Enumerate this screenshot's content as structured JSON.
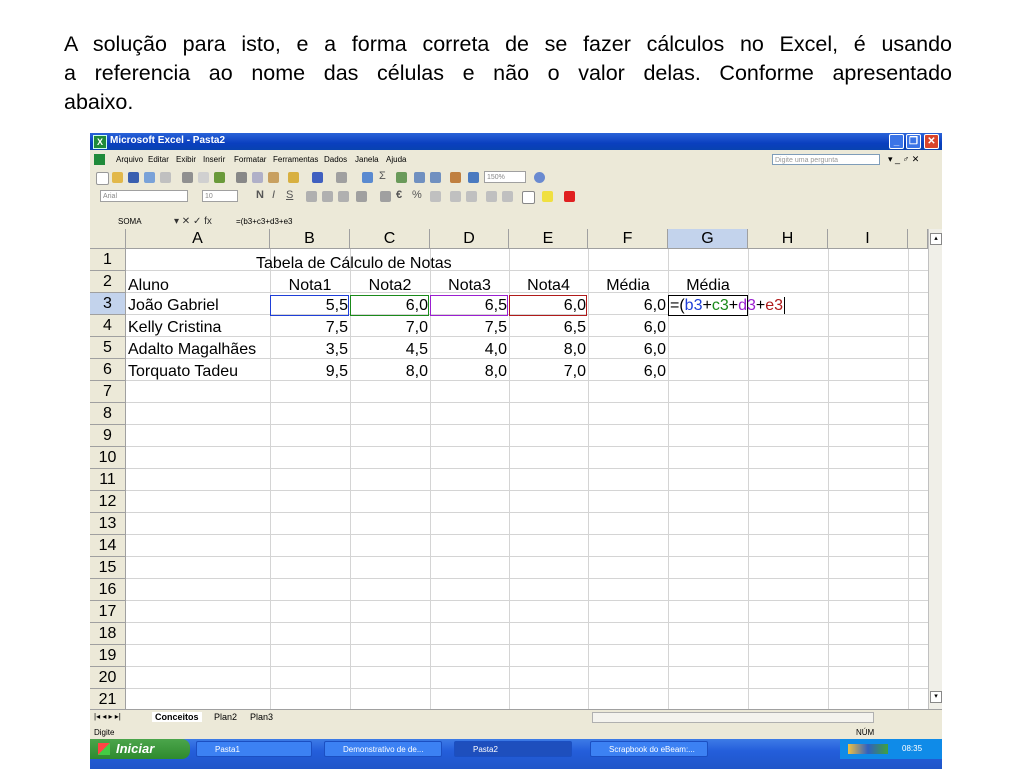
{
  "intro": {
    "line1": "A solução para isto, e a forma correta de se fazer cálculos no Excel, é usando",
    "line2": "a referencia ao nome das células e não o valor delas. Conforme apresentado",
    "line3": "abaixo."
  },
  "window": {
    "title": "Microsoft Excel - Pasta2",
    "minimize": "_",
    "restore": "❐",
    "close": "✕"
  },
  "menu": {
    "items": [
      "Arquivo",
      "Editar",
      "Exibir",
      "Inserir",
      "Formatar",
      "Ferramentas",
      "Dados",
      "Janela",
      "Ajuda"
    ],
    "ask_placeholder": "Digite uma pergunta",
    "doc_controls": "▾ _ ♂ ✕"
  },
  "toolbar": {
    "zoom": "150%",
    "font_name": "Arial",
    "font_size": "10"
  },
  "formula_bar": {
    "name_box": "SOMA",
    "buttons": "▾ ✕ ✓ fx",
    "formula": "=(b3+c3+d3+e3"
  },
  "columns": [
    "A",
    "B",
    "C",
    "D",
    "E",
    "F",
    "G",
    "H",
    "I"
  ],
  "selected_column": "G",
  "rows": [
    "1",
    "2",
    "3",
    "4",
    "5",
    "6",
    "7",
    "8",
    "9",
    "10",
    "11",
    "12",
    "13",
    "14",
    "15",
    "16",
    "17",
    "18",
    "19",
    "20",
    "21"
  ],
  "selected_row": "3",
  "sheet": {
    "title": "Tabela de Cálculo de Notas",
    "headers": [
      "Aluno",
      "Nota1",
      "Nota2",
      "Nota3",
      "Nota4",
      "Média",
      "Média"
    ],
    "data": [
      {
        "aluno": "João Gabriel",
        "n1": "5,5",
        "n2": "6,0",
        "n3": "6,5",
        "n4": "6,0",
        "media": "6,0"
      },
      {
        "aluno": "Kelly Cristina",
        "n1": "7,5",
        "n2": "7,0",
        "n3": "7,5",
        "n4": "6,5",
        "media": "6,0"
      },
      {
        "aluno": "Adalto Magalhães",
        "n1": "3,5",
        "n2": "4,5",
        "n3": "4,0",
        "n4": "8,0",
        "media": "6,0"
      },
      {
        "aluno": "Torquato Tadeu",
        "n1": "9,5",
        "n2": "8,0",
        "n3": "8,0",
        "n4": "7,0",
        "media": "6,0"
      }
    ],
    "edit_cell": {
      "prefix": "=(",
      "ref1": "b3",
      "p1": "+",
      "ref2": "c3",
      "p2": "+",
      "ref3": "d3",
      "p3": "+",
      "ref4": "e3"
    }
  },
  "ref_colors": {
    "b3": "#1f3fd8",
    "c3": "#1a8a1a",
    "d3": "#9b1fd0",
    "e3": "#b01a1a"
  },
  "sheet_tabs": [
    "Conceitos",
    "Plan2",
    "Plan3"
  ],
  "active_tab": "Conceitos",
  "status": {
    "mode": "Digite",
    "num": "NÚM"
  },
  "taskbar": {
    "start": "Iniciar",
    "tasks": [
      "Pasta1",
      "Demonstrativo de de...",
      "Pasta2",
      "Scrapbook do eBeam:..."
    ],
    "clock": "08:35"
  }
}
